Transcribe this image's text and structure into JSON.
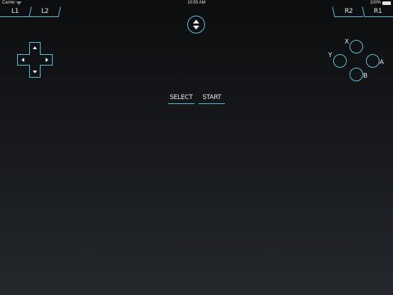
{
  "status_bar": {
    "carrier": "Carrier",
    "time": "10:55 AM",
    "battery": "100%"
  },
  "shoulder_buttons": {
    "l1": "L1",
    "l2": "L2",
    "r2": "R2",
    "r1": "R1"
  },
  "face_buttons": {
    "x": "X",
    "y": "Y",
    "a": "A",
    "b": "B"
  },
  "center_buttons": {
    "select": "SELECT",
    "start": "START"
  },
  "colors": {
    "accent": "#5ec4de",
    "text": "#e8eef2",
    "background_top": "#0c0d0f",
    "background_bottom": "#24272c"
  }
}
